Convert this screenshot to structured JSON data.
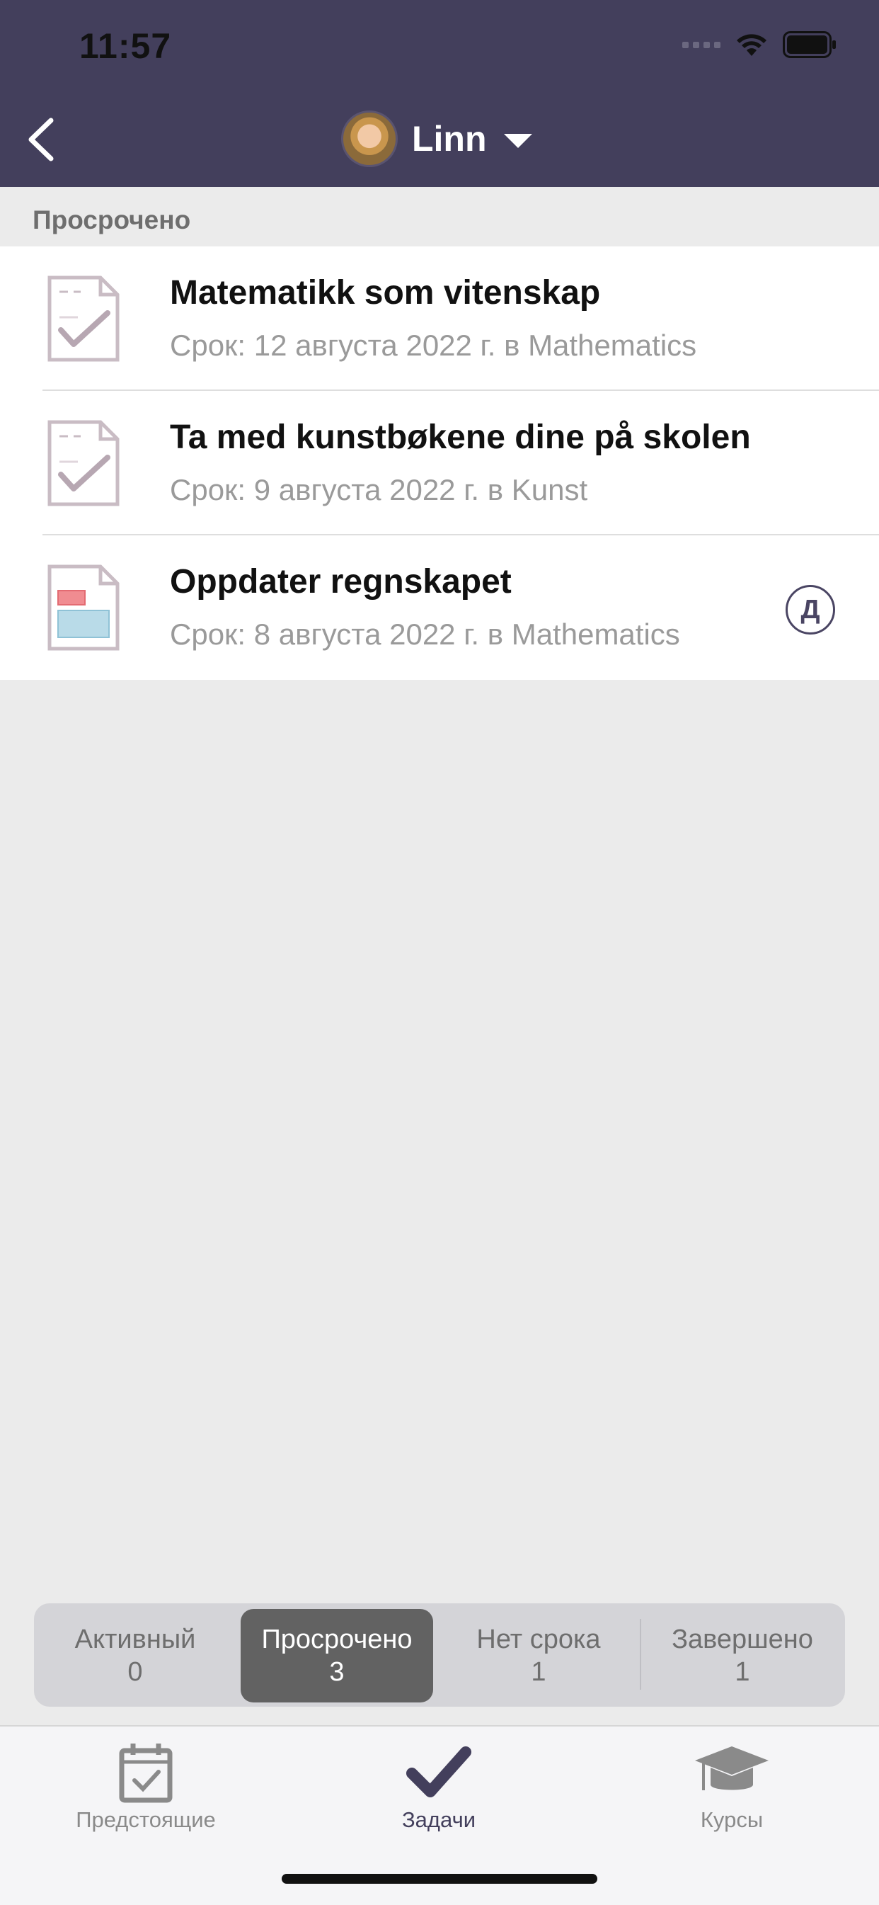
{
  "status_bar": {
    "time": "11:57"
  },
  "header": {
    "profile_name": "Linn"
  },
  "section": {
    "title": "Просрочено"
  },
  "tasks": [
    {
      "title": "Matematikk som vitenskap",
      "subtitle": "Срок: 12 августа 2022 г. в Mathematics",
      "icon": "assignment-check-icon"
    },
    {
      "title": "Ta med kunstbøkene dine på skolen",
      "subtitle": "Срок: 9 августа 2022 г. в Kunst",
      "icon": "assignment-check-icon"
    },
    {
      "title": "Oppdater regnskapet",
      "subtitle": "Срок: 8 августа 2022 г. в Mathematics",
      "icon": "form-document-icon",
      "badge": "Д"
    }
  ],
  "filters": [
    {
      "label": "Активный",
      "count": "0",
      "selected": false
    },
    {
      "label": "Просрочено",
      "count": "3",
      "selected": true
    },
    {
      "label": "Нет срока",
      "count": "1",
      "selected": false
    },
    {
      "label": "Завершено",
      "count": "1",
      "selected": false
    }
  ],
  "tabbar": [
    {
      "label": "Предстоящие",
      "icon": "calendar-check-icon",
      "active": false
    },
    {
      "label": "Задачи",
      "icon": "checkmark-icon",
      "active": true
    },
    {
      "label": "Курсы",
      "icon": "graduation-cap-icon",
      "active": false
    }
  ],
  "colors": {
    "header_bg": "#433f5c",
    "accent": "#433f5c",
    "segment_active": "#626262"
  }
}
